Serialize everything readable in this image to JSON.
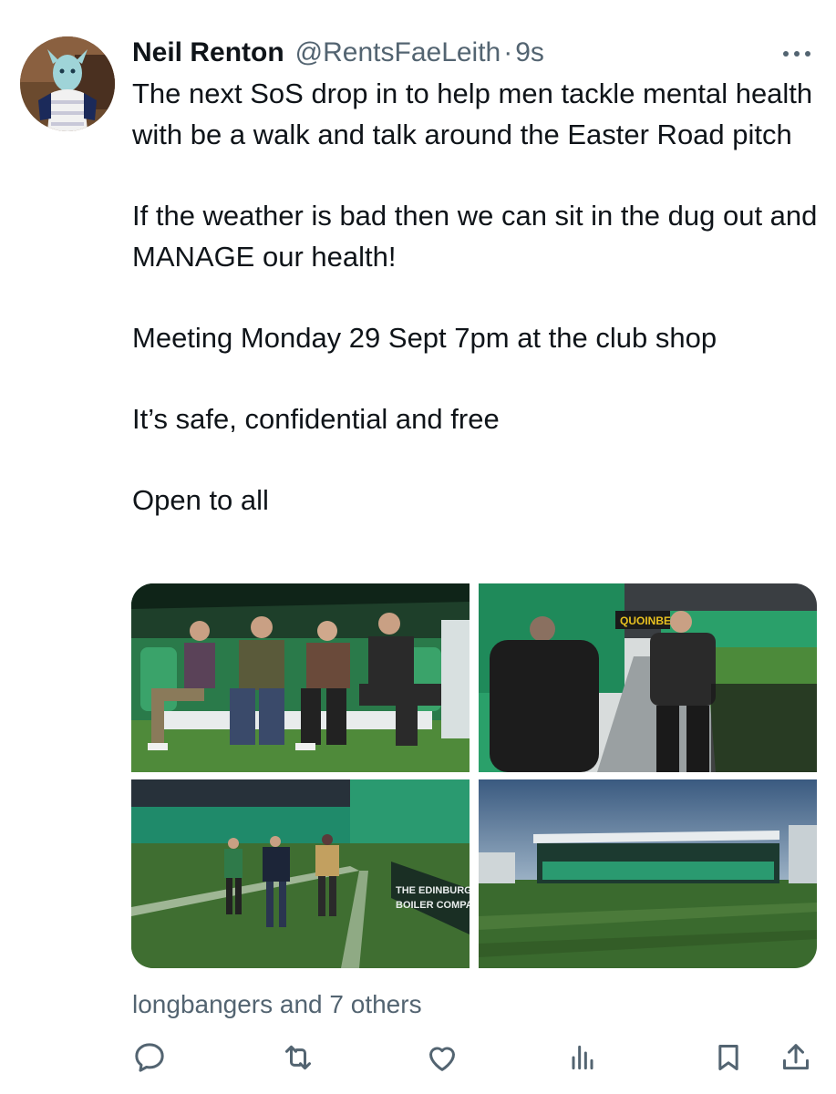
{
  "tweet": {
    "author": {
      "display_name": "Neil Renton",
      "handle": "@RentsFaeLeith",
      "separator": "·",
      "time_ago": "9s"
    },
    "paragraphs": [
      "The next SoS drop in to help men tackle mental health with be a walk and talk around the Easter Road pitch",
      "If the weather is bad then we can sit in the dug out and MANAGE our health!",
      "Meeting Monday 29 Sept 7pm at the club shop",
      "It’s safe, confidential and free",
      "Open to all"
    ],
    "media_count": 4,
    "photos": {
      "photo2_sign": "QUOINBET",
      "photo3_sign_line1": "THE EDINBURG",
      "photo3_sign_line2": "BOILER COMPA"
    },
    "liked_by": "longbangers and 7 others"
  },
  "actions": [
    {
      "name": "reply",
      "icon": "reply-icon"
    },
    {
      "name": "retweet",
      "icon": "retweet-icon"
    },
    {
      "name": "like",
      "icon": "heart-icon"
    },
    {
      "name": "views",
      "icon": "views-icon"
    },
    {
      "name": "bookmark",
      "icon": "bookmark-icon"
    },
    {
      "name": "share",
      "icon": "share-icon"
    }
  ],
  "colors": {
    "text_primary": "#0f1419",
    "text_secondary": "#536471",
    "pitch_green": "#3f6b2f",
    "stand_green": "#1d8a62"
  }
}
